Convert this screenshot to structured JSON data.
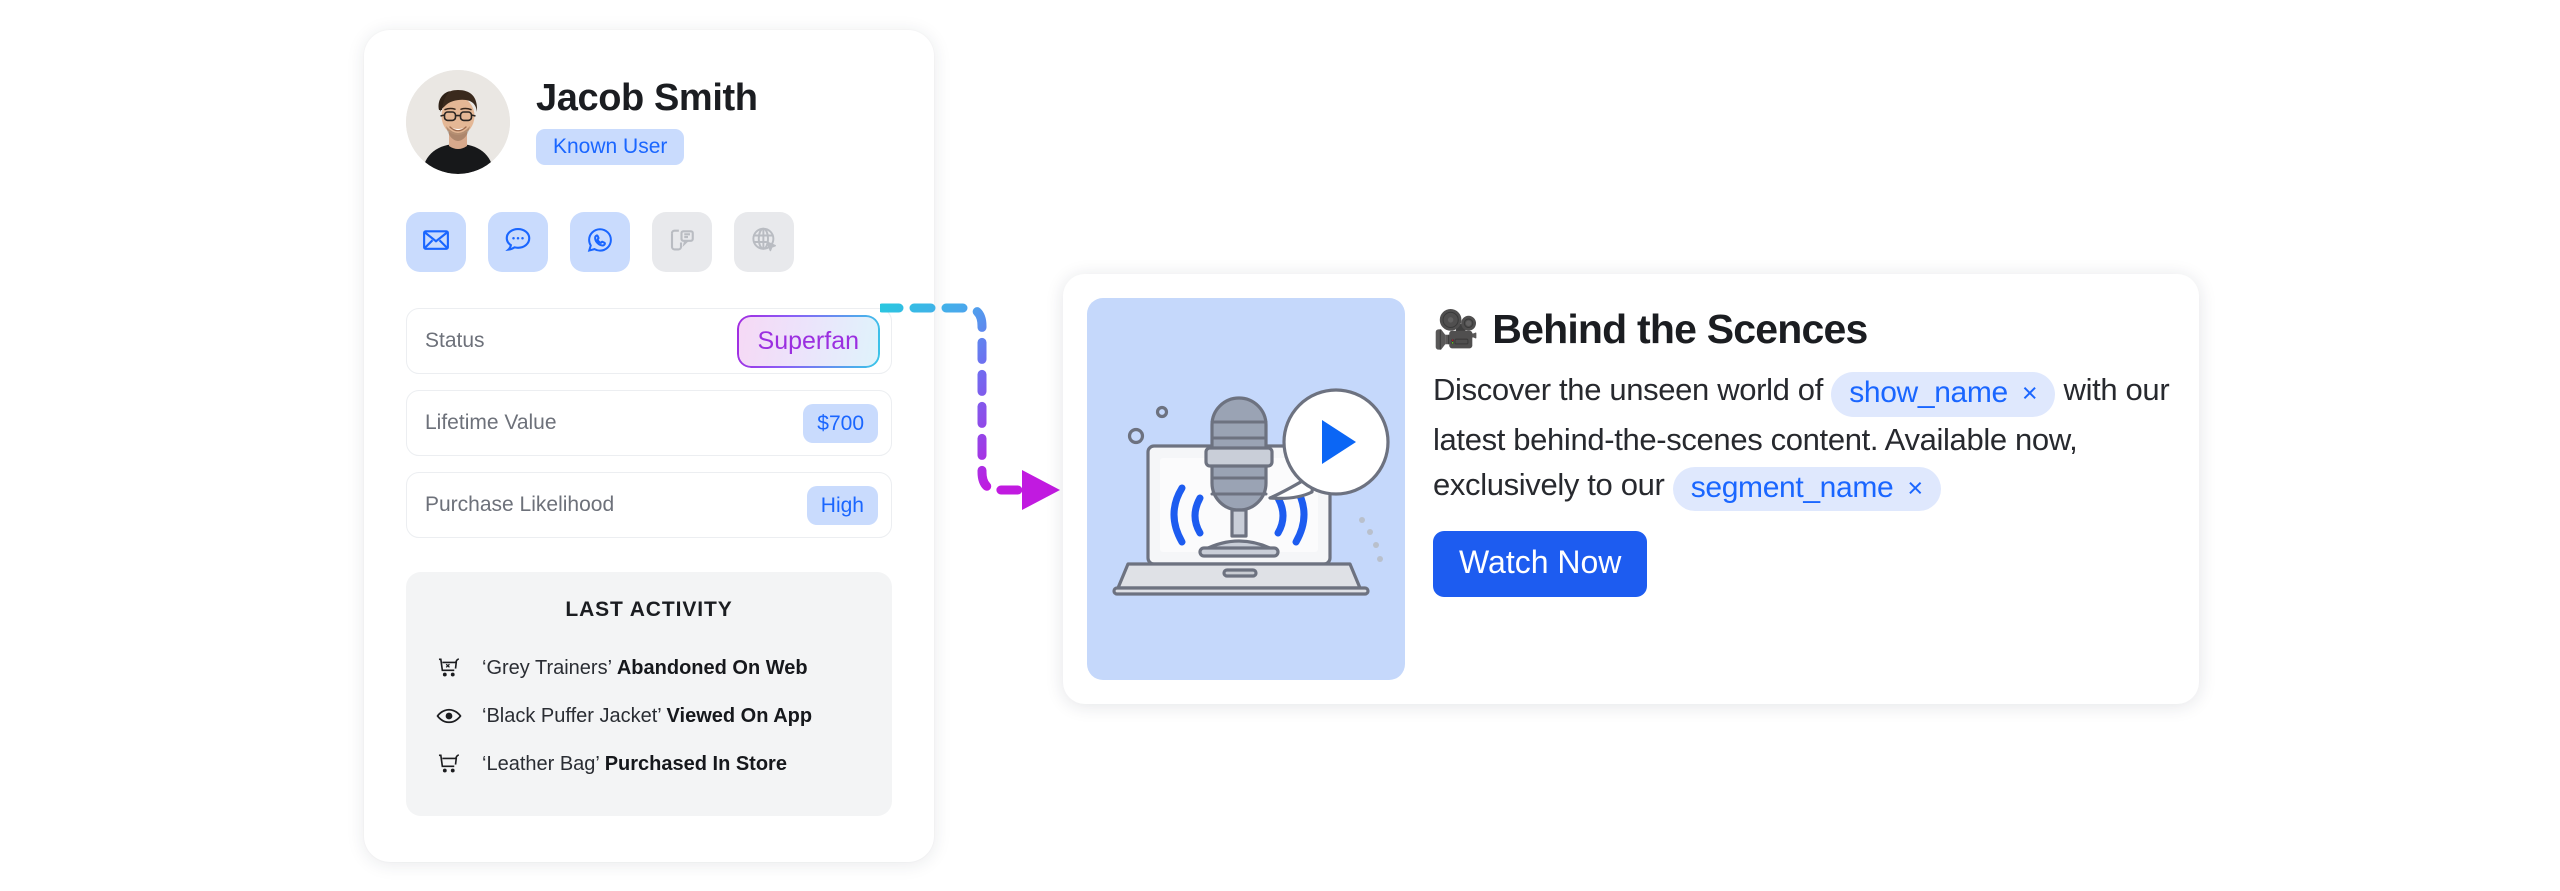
{
  "profile": {
    "avatar_name": "jacob-smith-photo",
    "name": "Jacob Smith",
    "badge": "Known User",
    "channels": [
      {
        "name": "email-icon",
        "label": "Email",
        "active": true
      },
      {
        "name": "sms-icon",
        "label": "SMS",
        "active": true
      },
      {
        "name": "whatsapp-icon",
        "label": "WhatsApp",
        "active": true
      },
      {
        "name": "in-app-message-icon",
        "label": "In-App Message",
        "active": false
      },
      {
        "name": "web-icon",
        "label": "Web",
        "active": false
      }
    ],
    "attributes": [
      {
        "label": "Status",
        "value": "Superfan",
        "style": "gradient"
      },
      {
        "label": "Lifetime Value",
        "value": "$700",
        "style": "blue"
      },
      {
        "label": "Purchase Likelihood",
        "value": "High",
        "style": "blue"
      }
    ],
    "activity": {
      "title": "LAST ACTIVITY",
      "items": [
        {
          "icon": "cart-abandoned-icon",
          "product": "‘Grey Trainers’",
          "action": "Abandoned On Web"
        },
        {
          "icon": "eye-icon",
          "product": "‘Black Puffer Jacket’",
          "action": "Viewed On App"
        },
        {
          "icon": "cart-icon",
          "product": "‘Leather Bag’",
          "action": "Purchased In Store"
        }
      ]
    }
  },
  "message": {
    "thumbnail_name": "podcast-laptop-illustration",
    "title_emoji": "🎥",
    "title": "Behind the Scences",
    "text_part_1": "Discover the unseen world of",
    "token_1": "show_name",
    "text_part_2": "with our latest behind-the-scenes content. Available now, exclusively to our",
    "token_2": "segment_name",
    "token_remove_glyph": "×",
    "cta_label": "Watch Now"
  },
  "connector": {
    "name": "dashed-flow-arrow",
    "start_color": "#2ac6e0",
    "mid_color": "#6f6ef0",
    "end_color": "#c11ae0"
  },
  "colors": {
    "accent_blue": "#1a66ff",
    "cta_blue": "#1d5cf0",
    "badge_bg": "#c9dbfd",
    "token_bg": "#dfe8fd",
    "thumb_bg": "#c5d8fb",
    "activity_bg": "#f3f4f5",
    "superfan_text": "#9b2fe0"
  }
}
